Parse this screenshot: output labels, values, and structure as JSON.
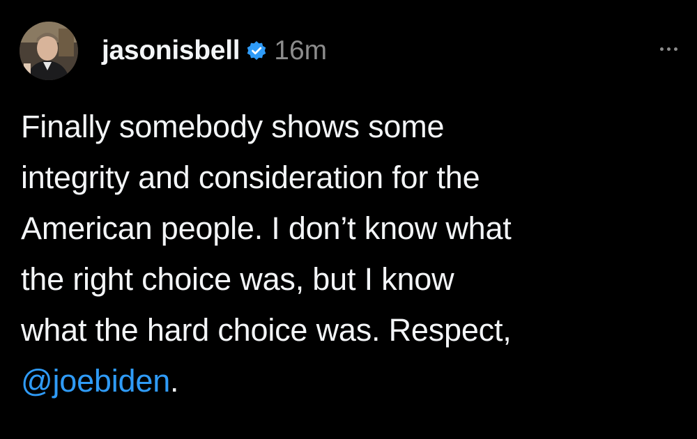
{
  "post": {
    "author": {
      "username": "jasonisbell",
      "verified": true,
      "avatar": "avatar-photo"
    },
    "timestamp": "16m",
    "more_icon": "more-horizontal-icon",
    "body": {
      "text_lines": [
        "Finally somebody shows some",
        "integrity and consideration for the",
        "American people. I don’t know what",
        "the right choice was, but I know",
        "what the hard choice was. Respect,"
      ],
      "mention": "@joebiden",
      "trailing": "."
    }
  },
  "colors": {
    "background": "#000000",
    "text": "#f3f5f7",
    "muted": "#8c8c8c",
    "link": "#2f9bf7",
    "verified": "#2f9bf7"
  }
}
